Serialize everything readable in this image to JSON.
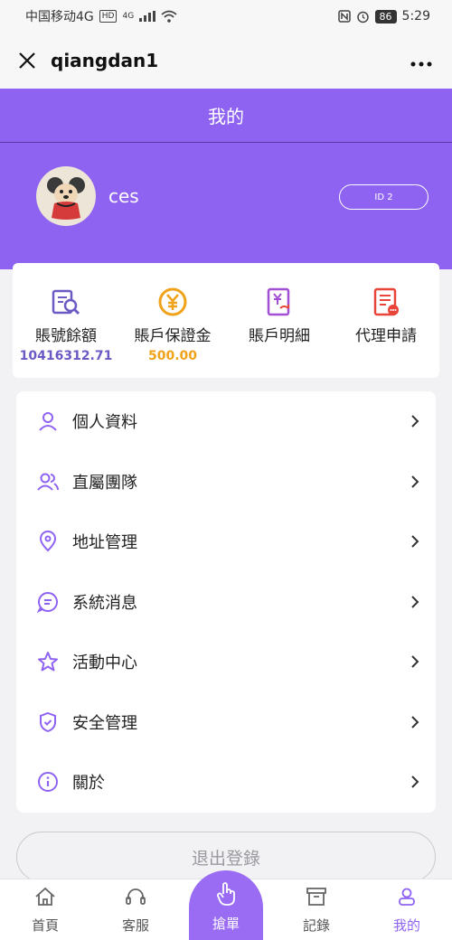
{
  "status_bar": {
    "carrier": "中国移动4G",
    "hd": "HD",
    "net": "4G",
    "battery": "86",
    "time": "5:29"
  },
  "title_bar": {
    "title": "qiangdan1"
  },
  "header": {
    "title": "我的",
    "username": "ces",
    "id_label": "ID 2"
  },
  "stats": [
    {
      "label": "賬號餘額",
      "value": "10416312.71",
      "icon": "wallet-search-icon",
      "color": "#6b59c4"
    },
    {
      "label": "賬戶保證金",
      "value": "500.00",
      "icon": "yuan-coin-icon",
      "color": "#f0a21a"
    },
    {
      "label": "賬戶明細",
      "value": "",
      "icon": "yuan-refresh-icon",
      "color": "#a24fd6"
    },
    {
      "label": "代理申請",
      "value": "",
      "icon": "document-icon",
      "color": "#e8443a"
    }
  ],
  "menu": [
    {
      "label": "個人資料",
      "icon": "user-icon"
    },
    {
      "label": "直屬團隊",
      "icon": "team-icon"
    },
    {
      "label": "地址管理",
      "icon": "location-icon"
    },
    {
      "label": "系統消息",
      "icon": "message-icon"
    },
    {
      "label": "活動中心",
      "icon": "star-icon"
    },
    {
      "label": "安全管理",
      "icon": "shield-icon"
    },
    {
      "label": "關於",
      "icon": "info-icon"
    }
  ],
  "logout_label": "退出登錄",
  "tabs": [
    {
      "label": "首頁",
      "icon": "home-icon"
    },
    {
      "label": "客服",
      "icon": "headset-icon"
    },
    {
      "label": "搶單",
      "icon": "hand-tap-icon"
    },
    {
      "label": "記錄",
      "icon": "archive-icon"
    },
    {
      "label": "我的",
      "icon": "profile-icon",
      "active": true
    }
  ],
  "colors": {
    "brand": "#8f63f2",
    "balance": "#6b59c4",
    "deposit": "#f0a21a"
  }
}
